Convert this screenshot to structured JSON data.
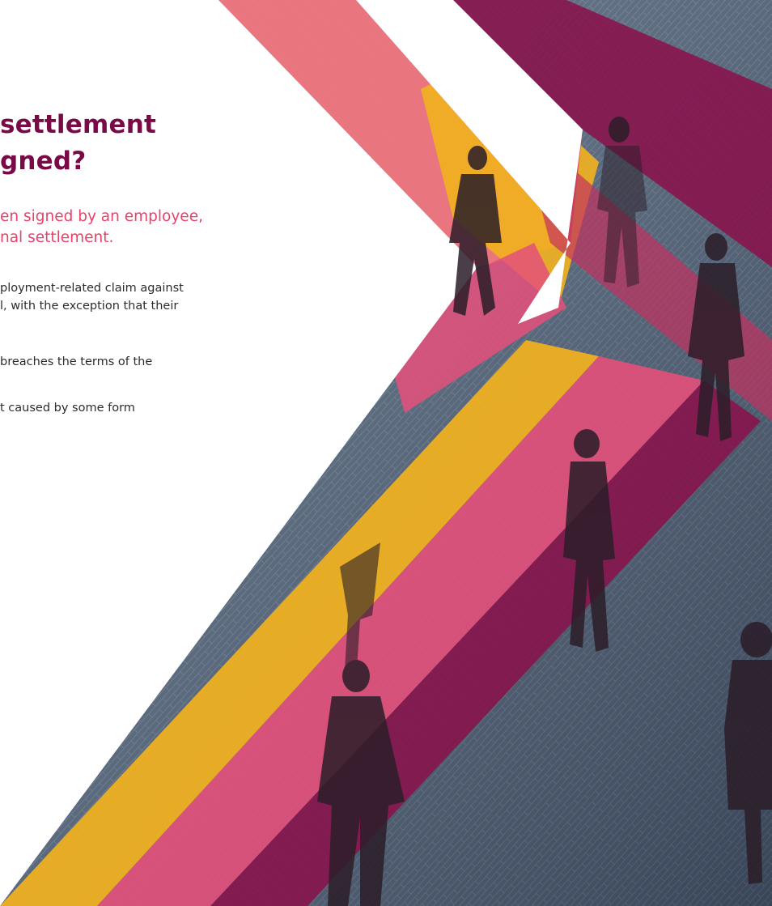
{
  "heading": {
    "line1": "settlement",
    "line2": "gned?"
  },
  "intro": {
    "line1": "en signed by an employee,",
    "line2": "nal settlement."
  },
  "paragraphs": [
    {
      "line1": "ployment-related claim against",
      "line2": "l, with the exception that their"
    },
    {
      "line1": "breaches the terms of the"
    },
    {
      "line1": "t caused by some form"
    }
  ],
  "colors": {
    "heading": "#7a0a46",
    "accent_text": "#e8426a",
    "body_text": "#2c2c2c",
    "stripe_maroon": "#8a0f4a",
    "stripe_pink": "#e4507a",
    "stripe_coral": "#f0767d",
    "stripe_yellow": "#f2b21e",
    "pavement": "#5d6f86"
  },
  "image": {
    "subject": "people-walking-on-brick-pavement-photo"
  }
}
